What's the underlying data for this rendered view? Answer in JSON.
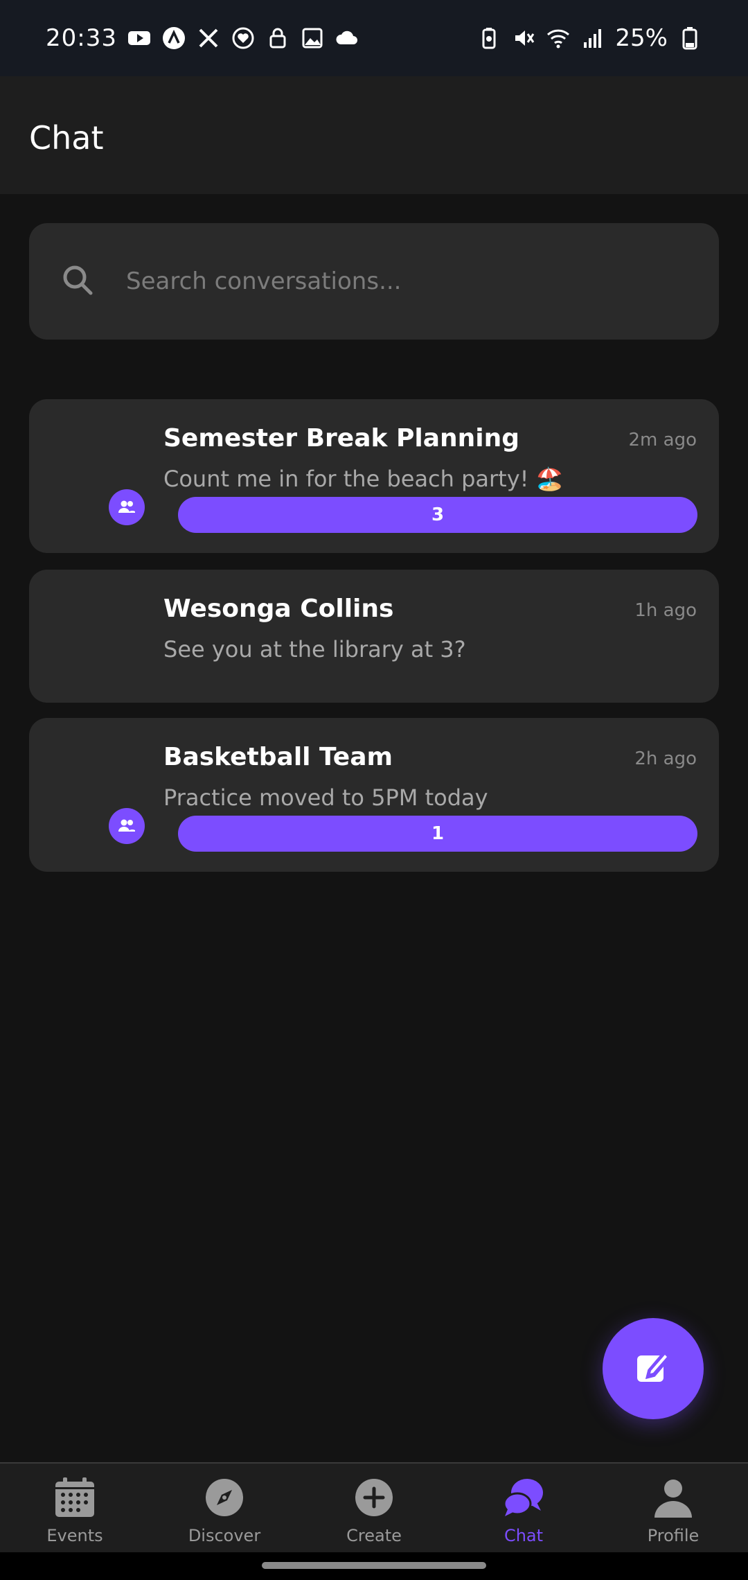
{
  "status_bar": {
    "time": "20:33",
    "battery": "25%",
    "left_icons": [
      "youtube-icon",
      "arc-icon",
      "x-icon",
      "heart-icon",
      "lock-icon",
      "gallery-icon",
      "cloud-icon"
    ],
    "right_icons": [
      "battery-saver-icon",
      "mute-icon",
      "wifi-icon",
      "signal-icon",
      "battery-icon"
    ]
  },
  "header": {
    "title": "Chat"
  },
  "search": {
    "placeholder": "Search conversations..."
  },
  "conversations": [
    {
      "name": "Semester Break Planning",
      "time": "2m ago",
      "preview": "Count me in for the beach party! 🏖️",
      "is_group": true,
      "unread": "3"
    },
    {
      "name": "Wesonga Collins",
      "time": "1h ago",
      "preview": "See you at the library at 3?",
      "is_group": false,
      "unread": ""
    },
    {
      "name": "Basketball Team",
      "time": "2h ago",
      "preview": "Practice moved to 5PM today",
      "is_group": true,
      "unread": "1"
    }
  ],
  "fab": {
    "icon": "edit-icon"
  },
  "bottom_nav": {
    "items": [
      {
        "label": "Events",
        "icon": "calendar-icon",
        "active": false
      },
      {
        "label": "Discover",
        "icon": "compass-icon",
        "active": false
      },
      {
        "label": "Create",
        "icon": "plus-circle-icon",
        "active": false
      },
      {
        "label": "Chat",
        "icon": "chat-bubbles-icon",
        "active": true
      },
      {
        "label": "Profile",
        "icon": "person-icon",
        "active": false
      }
    ]
  },
  "colors": {
    "accent": "#7c4dff",
    "background": "#131313",
    "card": "#2a2a2a",
    "header": "#1e1e1e"
  }
}
